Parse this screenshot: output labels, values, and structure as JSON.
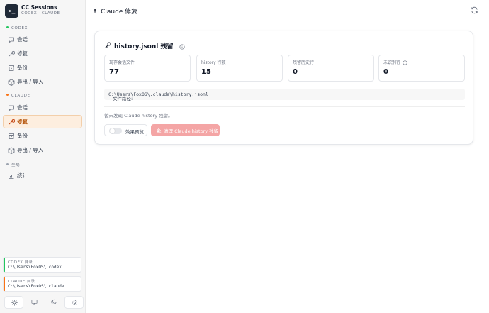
{
  "app": {
    "logo": ">_",
    "title": "CC Sessions",
    "subtitle": "CODEX · CLAUDE"
  },
  "sidebar": {
    "sections": [
      {
        "label": "CODEX",
        "color": "#22c55e",
        "items": [
          {
            "label": "会话",
            "icon": "message-icon"
          },
          {
            "label": "修复",
            "icon": "wrench-icon"
          },
          {
            "label": "备份",
            "icon": "archive-icon"
          },
          {
            "label": "导出 / 导入",
            "icon": "package-icon"
          }
        ]
      },
      {
        "label": "CLAUDE",
        "color": "#f97316",
        "items": [
          {
            "label": "会话",
            "icon": "message-icon"
          },
          {
            "label": "修复",
            "icon": "wrench-icon",
            "active": true
          },
          {
            "label": "备份",
            "icon": "archive-icon"
          },
          {
            "label": "导出 / 导入",
            "icon": "package-icon"
          }
        ]
      },
      {
        "label": "全局",
        "color": "#9ca3af",
        "items": [
          {
            "label": "统计",
            "icon": "chart-icon"
          }
        ]
      }
    ],
    "dirs": [
      {
        "label": "CODEX 目录",
        "path": "C:\\Users\\FoxOS\\.codex",
        "color": "#22c55e"
      },
      {
        "label": "CLAUDE 目录",
        "path": "C:\\Users\\FoxOS\\.claude",
        "color": "#f97316"
      }
    ],
    "theme": {
      "options": [
        "light-theme-icon",
        "system-theme-icon",
        "dark-theme-icon",
        "settings-icon"
      ],
      "selected": "light"
    }
  },
  "header": {
    "marker": "!",
    "title": "Claude 修复"
  },
  "card": {
    "title": "history.jsonl 残留",
    "stats": [
      {
        "label": "现存会话文件",
        "value": "77"
      },
      {
        "label": "history 行数",
        "value": "15"
      },
      {
        "label": "残留历史行",
        "value": "0"
      },
      {
        "label": "未识别行",
        "value": "0",
        "has_info": true
      }
    ],
    "path_label": "文件路径:",
    "path": "C:\\Users\\FoxOS\\.claude\\history.jsonl",
    "note": "暂未发现 Claude history 残留。",
    "toggle": {
      "label": "效果预览",
      "on": false
    },
    "clean_button": "清理 Claude history 残留"
  },
  "colors": {
    "accent": "#f97316",
    "active_bg": "#fdeedf",
    "danger_disabled": "#f4a5a5"
  }
}
